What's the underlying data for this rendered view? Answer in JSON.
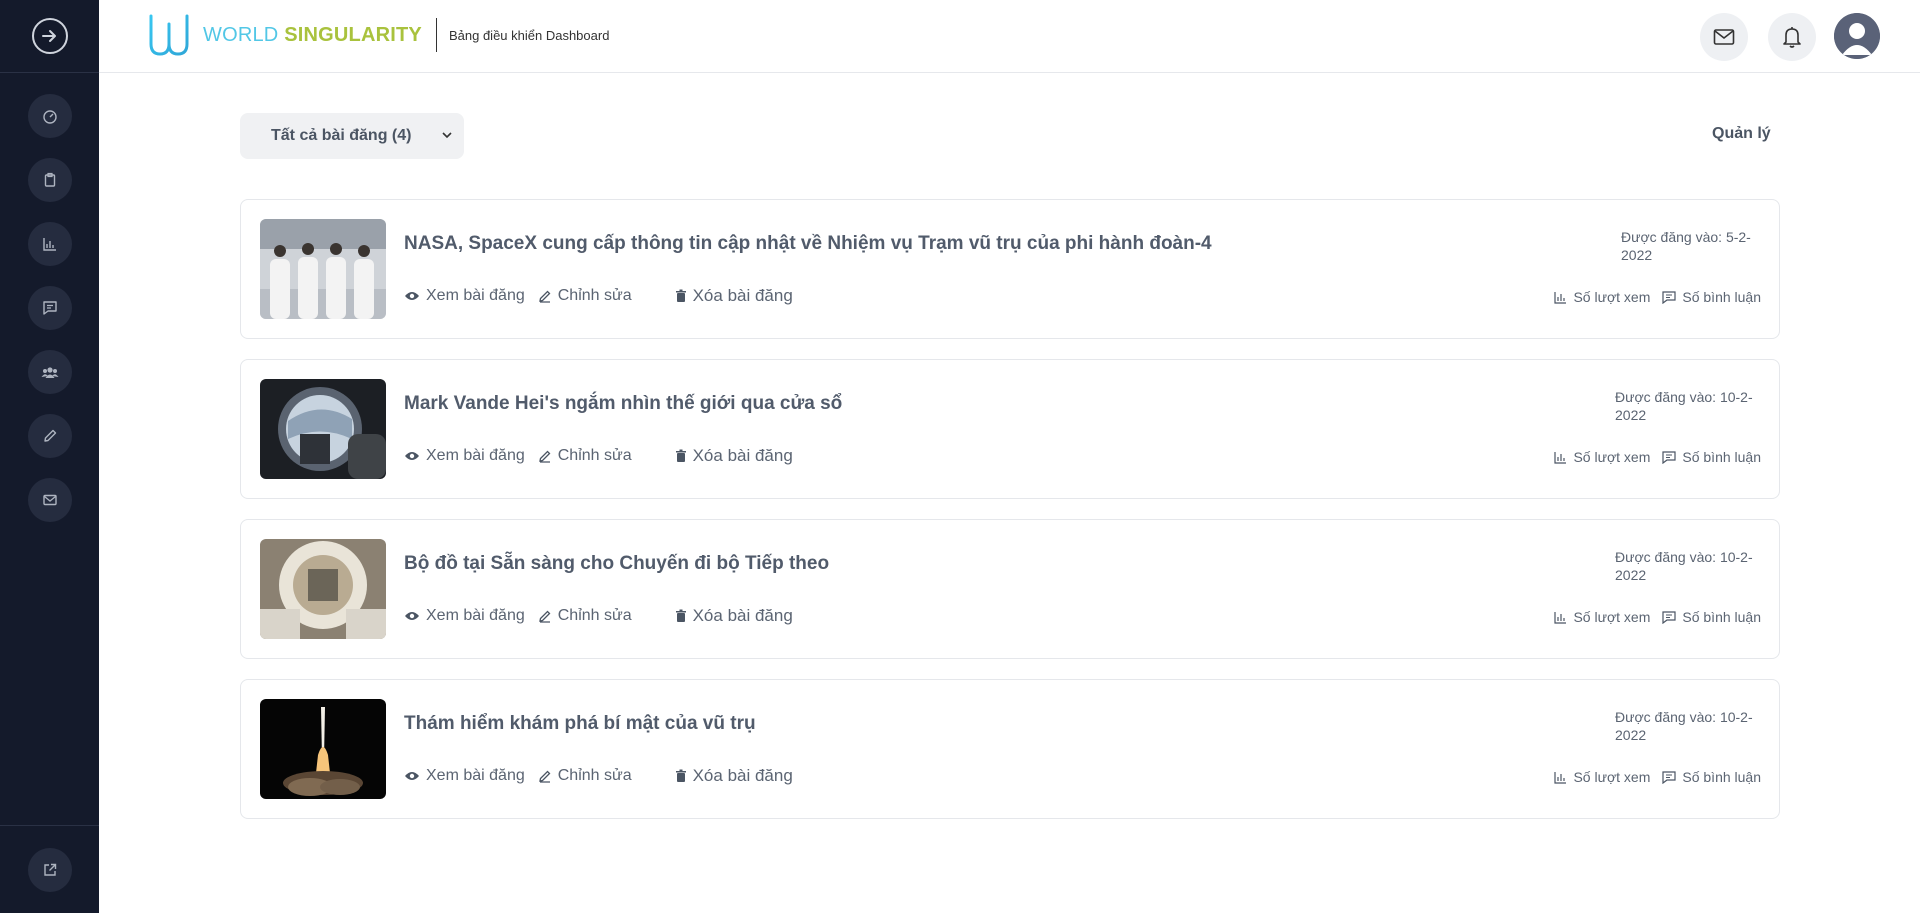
{
  "header": {
    "logo_word1": "WORLD",
    "logo_word2": "SINGULARITY",
    "subtitle": "Bảng điều khiển Dashboard",
    "mail_icon": "mail-icon",
    "bell_icon": "bell-icon"
  },
  "sidebar": {
    "toggle_icon": "arrow-right-circle-icon",
    "items": [
      {
        "icon": "dashboard-gauge-icon"
      },
      {
        "icon": "clipboard-icon"
      },
      {
        "icon": "bar-chart-icon"
      },
      {
        "icon": "message-icon"
      },
      {
        "icon": "users-icon"
      },
      {
        "icon": "pencil-icon"
      },
      {
        "icon": "mail-icon"
      }
    ],
    "bottom_icon": "external-link-icon"
  },
  "toolbar": {
    "filter_label": "Tất cả bài đăng (4)",
    "manage_label": "Quản lý"
  },
  "colors": {
    "sidebar_bg": "#141a2b",
    "logo_cyan": "#52c7e6",
    "logo_green": "#a9c23d"
  },
  "posts": [
    {
      "title": "NASA, SpaceX cung cấp thông tin cập nhật về Nhiệm vụ Trạm vũ trụ của phi hành đoàn-4",
      "view_label": "Xem bài đăng",
      "edit_label": "Chỉnh sửa",
      "delete_label": "Xóa bài đăng",
      "date_line1": "Được đăng vào: 5-2-",
      "date_line2": "2022",
      "views_label": "Số lượt xem",
      "comments_label": "Số bình luận"
    },
    {
      "title": "Mark Vande Hei's ngắm nhìn thế giới qua cửa sổ",
      "view_label": "Xem bài đăng",
      "edit_label": "Chỉnh sửa",
      "delete_label": "Xóa bài đăng",
      "date_line1": "Được đăng vào: 10-2-",
      "date_line2": "2022",
      "views_label": "Số lượt xem",
      "comments_label": "Số bình luận"
    },
    {
      "title": "Bộ đồ tại Sẵn sàng cho Chuyến đi bộ Tiếp theo",
      "view_label": "Xem bài đăng",
      "edit_label": "Chỉnh sửa",
      "delete_label": "Xóa bài đăng",
      "date_line1": "Được đăng vào: 10-2-",
      "date_line2": "2022",
      "views_label": "Số lượt xem",
      "comments_label": "Số bình luận"
    },
    {
      "title": "Thám hiểm khám phá bí mật của vũ trụ",
      "view_label": "Xem bài đăng",
      "edit_label": "Chỉnh sửa",
      "delete_label": "Xóa bài đăng",
      "date_line1": "Được đăng vào: 10-2-",
      "date_line2": "2022",
      "views_label": "Số lượt xem",
      "comments_label": "Số bình luận"
    }
  ]
}
